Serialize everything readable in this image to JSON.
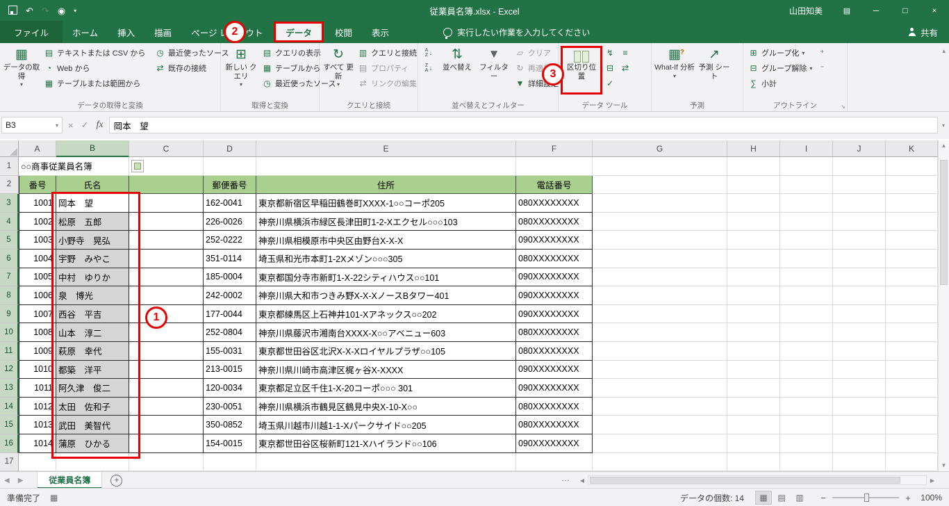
{
  "title_bar": {
    "title": "従業員名簿.xlsx -  Excel",
    "user": "山田知美"
  },
  "tabs": {
    "items": [
      {
        "label": "ファイル"
      },
      {
        "label": "ホーム"
      },
      {
        "label": "挿入"
      },
      {
        "label": "描画"
      },
      {
        "label": "ページ レイアウト"
      },
      {
        "label": "データ"
      },
      {
        "label": "校閲"
      },
      {
        "label": "表示"
      }
    ],
    "tell_me": "実行したい作業を入力してください",
    "share": "共有"
  },
  "ribbon": {
    "get_transform": {
      "label": "データの取得と変換",
      "get_data": "データの取 得",
      "from_text_csv": "テキストまたは CSV から",
      "from_web": "Web から",
      "from_table_range": "テーブルまたは範囲から",
      "recent_sources": "最近使ったソース",
      "existing_connections": "既存の接続"
    },
    "transform": {
      "label": "取得と変換",
      "new_query": "新しい クエリ",
      "show_queries": "クエリの表示",
      "from_table": "テーブルから",
      "recent_sources": "最近使ったソース"
    },
    "connections": {
      "label": "クエリと接続",
      "refresh_all": "すべて 更新",
      "queries_connections": "クエリと接続",
      "properties": "プロパティ",
      "edit_links": "リンクの編集"
    },
    "sort_filter": {
      "label": "並べ替えとフィルター",
      "sort": "並べ替え",
      "filter": "フィルター",
      "clear": "クリア",
      "reapply": "再適用",
      "advanced": "詳細設定"
    },
    "data_tools": {
      "label": "データ ツール",
      "text_to_columns": "区切り位置"
    },
    "forecast": {
      "label": "予測",
      "what_if": "What-If 分析",
      "forecast_sheet": "予測 シート"
    },
    "outline": {
      "label": "アウトライン",
      "group": "グループ化",
      "ungroup": "グループ解除",
      "subtotal": "小計"
    }
  },
  "formula_bar": {
    "name_box": "B3",
    "fx": "fx",
    "value": "岡本　望"
  },
  "grid": {
    "columns": [
      "A",
      "B",
      "C",
      "D",
      "E",
      "F",
      "G",
      "H",
      "I",
      "J",
      "K"
    ],
    "selected_column": "B",
    "selected_rows_from": 3,
    "selected_rows_to": 16,
    "rows_visible": 17
  },
  "sheet": {
    "title": "○○商事従業員名簿",
    "headers": [
      "番号",
      "氏名",
      "",
      "郵便番号",
      "住所",
      "電話番号"
    ],
    "rows": [
      [
        "1001",
        "岡本　望",
        "162-0041",
        "東京都新宿区早稲田鶴巻町XXXX-1○○コーポ205",
        "080XXXXXXXX"
      ],
      [
        "1002",
        "松原　五郎",
        "226-0026",
        "神奈川県横浜市緑区長津田町1-2-Xエクセル○○○103",
        "080XXXXXXXX"
      ],
      [
        "1003",
        "小野寺　晃弘",
        "252-0222",
        "神奈川県相模原市中央区由野台X-X-X",
        "090XXXXXXXX"
      ],
      [
        "1004",
        "宇野　みやこ",
        "351-0114",
        "埼玉県和光市本町1-2Xメゾン○○○305",
        "080XXXXXXXX"
      ],
      [
        "1005",
        "中村　ゆりか",
        "185-0004",
        "東京都国分寺市新町1-X-22シティハウス○○101",
        "090XXXXXXXX"
      ],
      [
        "1006",
        "泉　博光",
        "242-0002",
        "神奈川県大和市つきみ野X-X-XノースBタワー401",
        "090XXXXXXXX"
      ],
      [
        "1007",
        "西谷　平吉",
        "177-0044",
        "東京都練馬区上石神井101-Xアネックス○○202",
        "090XXXXXXXX"
      ],
      [
        "1008",
        "山本　淳二",
        "252-0804",
        "神奈川県藤沢市湘南台XXXX-X○○アベニュー603",
        "080XXXXXXXX"
      ],
      [
        "1009",
        "萩原　幸代",
        "155-0031",
        "東京都世田谷区北沢X-X-Xロイヤルプラザ○○105",
        "080XXXXXXXX"
      ],
      [
        "1010",
        "都築　洋平",
        "213-0015",
        "神奈川県川崎市高津区梶ヶ谷X-XXXX",
        "090XXXXXXXX"
      ],
      [
        "1011",
        "阿久津　俊二",
        "120-0034",
        "東京都足立区千住1-X-20コーポ○○○ 301",
        "090XXXXXXXX"
      ],
      [
        "1012",
        "太田　佐和子",
        "230-0051",
        "神奈川県横浜市鶴見区鶴見中央X-10-X○○",
        "080XXXXXXXX"
      ],
      [
        "1013",
        "武田　美智代",
        "350-0852",
        "埼玉県川越市川越1-1-Xパークサイド○○205",
        "080XXXXXXXX"
      ],
      [
        "1014",
        "蒲原　ひかる",
        "154-0015",
        "東京都世田谷区桜新町121-Xハイランド○○106",
        "090XXXXXXXX"
      ]
    ]
  },
  "annotations": {
    "step1": "1",
    "step2": "2",
    "step3": "3"
  },
  "sheet_tabs": {
    "active": "従業員名簿"
  },
  "status_bar": {
    "ready": "準備完了",
    "count": "データの個数: 14",
    "zoom": "100%"
  }
}
